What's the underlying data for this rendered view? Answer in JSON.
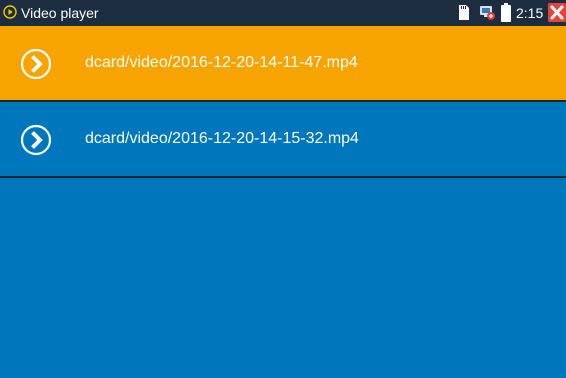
{
  "statusbar": {
    "app_title": "Video player",
    "time": "2:15 PM",
    "app_icon": "play-circle-icon",
    "sd_icon": "sd-card-icon",
    "usb_icon": "usb-connection-icon",
    "battery_icon": "battery-icon",
    "close_icon": "close-icon"
  },
  "files": [
    {
      "name": "dcard/video/2016-12-20-14-11-47.mp4",
      "selected": true,
      "icon": "play-circle-icon"
    },
    {
      "name": "dcard/video/2016-12-20-14-15-32.mp4",
      "selected": false,
      "icon": "play-circle-icon"
    }
  ],
  "colors": {
    "background": "#0077bd",
    "selected_row": "#f8a400",
    "statusbar": "#1b2d3f",
    "close_button": "#e8423a",
    "app_icon": "#f5c400"
  }
}
